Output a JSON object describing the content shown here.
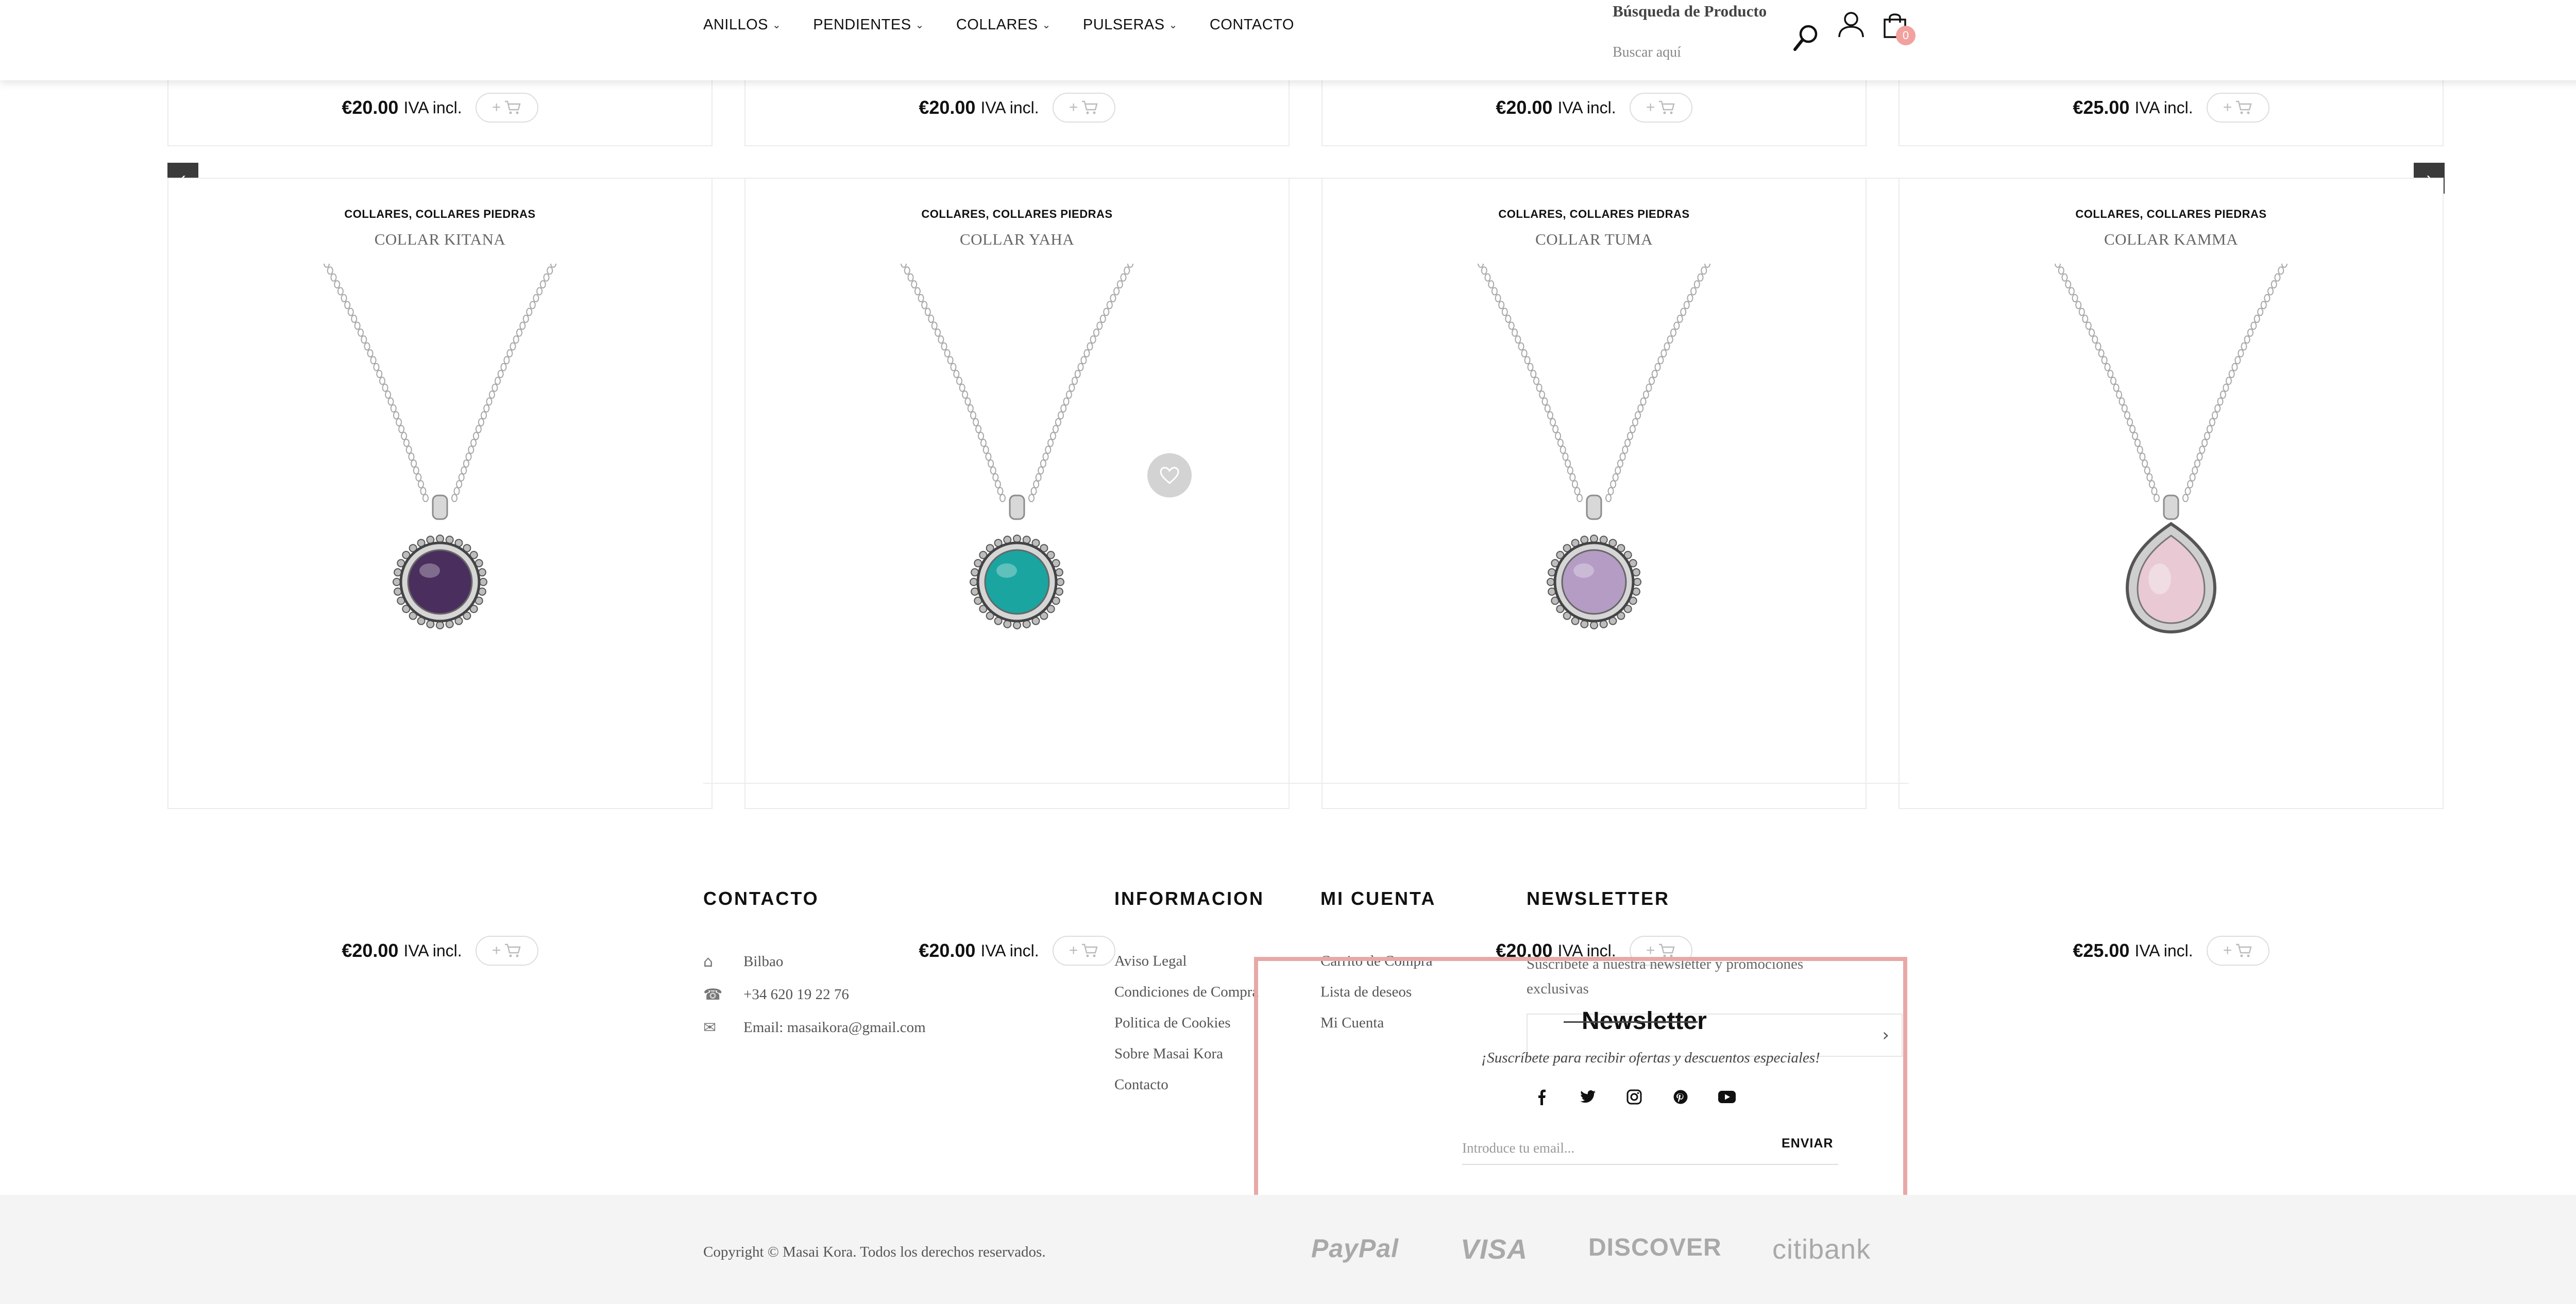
{
  "header": {
    "nav": [
      {
        "label": "ANILLOS",
        "dropdown": true
      },
      {
        "label": "PENDIENTES",
        "dropdown": true
      },
      {
        "label": "COLLARES",
        "dropdown": true
      },
      {
        "label": "PULSERAS",
        "dropdown": true
      },
      {
        "label": "CONTACTO",
        "dropdown": false
      }
    ],
    "search_title": "Búsqueda de Producto",
    "search_placeholder": "Buscar aquí",
    "cart_count": "0",
    "icons": [
      "search-icon",
      "user-icon",
      "shopping-bag-icon"
    ]
  },
  "products_row1": [
    {
      "price": "€20.00",
      "tax": "IVA incl."
    },
    {
      "price": "€20.00",
      "tax": "IVA incl."
    },
    {
      "price": "€20.00",
      "tax": "IVA incl."
    },
    {
      "price": "€25.00",
      "tax": "IVA incl."
    }
  ],
  "products_row2": [
    {
      "categories": "COLLARES, COLLARES PIEDRAS",
      "name": "COLLAR KITANA",
      "price": "€20.00",
      "tax": "IVA incl.",
      "stone_color": "#4a2e5e",
      "stone_shape": "round"
    },
    {
      "categories": "COLLARES, COLLARES PIEDRAS",
      "name": "COLLAR YAHA",
      "price": "€20.00",
      "tax": "IVA incl.",
      "stone_color": "#1aa5a0",
      "stone_shape": "round"
    },
    {
      "categories": "COLLARES, COLLARES PIEDRAS",
      "name": "COLLAR TUMA",
      "price": "€20.00",
      "tax": "IVA incl.",
      "stone_color": "#b49cc4",
      "stone_shape": "round"
    },
    {
      "categories": "COLLARES, COLLARES PIEDRAS",
      "name": "COLLAR KAMMA",
      "price": "€25.00",
      "tax": "IVA incl.",
      "stone_color": "#e8c9d4",
      "stone_shape": "drop"
    }
  ],
  "carousel": {
    "prev": "‹",
    "next": "›"
  },
  "footer": {
    "contacto": {
      "title": "CONTACTO",
      "items": [
        {
          "icon": "home-icon",
          "text": "Bilbao"
        },
        {
          "icon": "phone-icon",
          "text": "+34 620 19 22 76"
        },
        {
          "icon": "envelope-icon",
          "text": "Email: masaikora@gmail.com"
        }
      ]
    },
    "informacion": {
      "title": "INFORMACION",
      "links": [
        "Aviso Legal",
        "Condiciones de Compra",
        "Politica de Cookies",
        "Sobre Masai Kora",
        "Contacto"
      ]
    },
    "mi_cuenta": {
      "title": "MI CUENTA",
      "links": [
        "Carrito de Compra",
        "Lista de deseos",
        "Mi Cuenta"
      ]
    },
    "newsletter": {
      "title": "NEWSLETTER",
      "text": "Suscríbete a nuestra newsletter y promociones exclusivas"
    }
  },
  "popup": {
    "title": "Newsletter",
    "subtitle": "¡Suscríbete para recibir ofertas y descuentos especiales!",
    "socials": [
      "facebook-icon",
      "twitter-icon",
      "instagram-icon",
      "pinterest-icon",
      "youtube-icon"
    ],
    "email_placeholder": "Introduce tu email...",
    "send_label": "ENVIAR"
  },
  "bottom": {
    "copyright": "Copyright © Masai Kora. Todos los derechos reservados.",
    "payments": [
      "PayPal",
      "VISA",
      "DISCOVER",
      "citibank"
    ]
  },
  "colors": {
    "popup_border": "#e8a8a8",
    "cart_badge": "#f2a19e",
    "arrow_bg": "#3a3a3a"
  }
}
